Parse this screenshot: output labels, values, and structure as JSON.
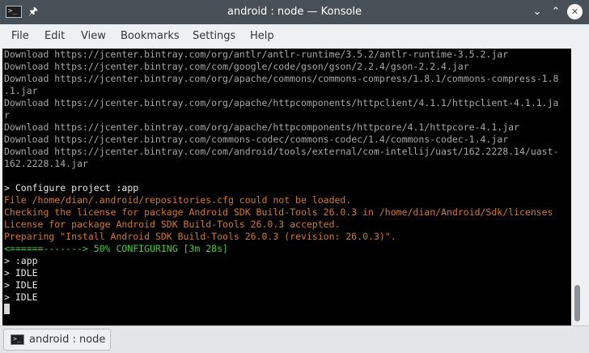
{
  "window": {
    "title": "android : node — Konsole",
    "app_icon": "terminal-icon",
    "pin_icon": "pin-icon",
    "controls": [
      "minimize-icon",
      "maximize-icon",
      "close-icon"
    ]
  },
  "menu": {
    "items": [
      {
        "label": "File"
      },
      {
        "label": "Edit"
      },
      {
        "label": "View"
      },
      {
        "label": "Bookmarks"
      },
      {
        "label": "Settings"
      },
      {
        "label": "Help"
      }
    ]
  },
  "terminal": {
    "background": "#000000",
    "colors": {
      "output": "#a8a8a8",
      "heading": "#e8e8e8",
      "warning": "#d47a22",
      "progress": "#3fcf3f"
    },
    "lines": [
      {
        "style": "output",
        "text": "Download https://jcenter.bintray.com/org/antlr/antlr-runtime/3.5.2/antlr-runtime-3.5.2.jar"
      },
      {
        "style": "output",
        "text": "Download https://jcenter.bintray.com/com/google/code/gson/gson/2.2.4/gson-2.2.4.jar"
      },
      {
        "style": "output",
        "text": "Download https://jcenter.bintray.com/org/apache/commons/commons-compress/1.8.1/commons-compress-1.8"
      },
      {
        "style": "output",
        "text": ".1.jar"
      },
      {
        "style": "output",
        "text": "Download https://jcenter.bintray.com/org/apache/httpcomponents/httpclient/4.1.1/httpclient-4.1.1.ja"
      },
      {
        "style": "output",
        "text": "r"
      },
      {
        "style": "output",
        "text": "Download https://jcenter.bintray.com/org/apache/httpcomponents/httpcore/4.1/httpcore-4.1.jar"
      },
      {
        "style": "output",
        "text": "Download https://jcenter.bintray.com/commons-codec/commons-codec/1.4/commons-codec-1.4.jar"
      },
      {
        "style": "output",
        "text": "Download https://jcenter.bintray.com/com/android/tools/external/com-intellij/uast/162.2228.14/uast-"
      },
      {
        "style": "output",
        "text": "162.2228.14.jar"
      },
      {
        "style": "output",
        "text": ""
      },
      {
        "style": "heading",
        "text": "> Configure project :app"
      },
      {
        "style": "warning",
        "text": "File /home/dian/.android/repositories.cfg could not be loaded."
      },
      {
        "style": "warning",
        "text": "Checking the license for package Android SDK Build-Tools 26.0.3 in /home/dian/Android/Sdk/licenses"
      },
      {
        "style": "warning",
        "text": "License for package Android SDK Build-Tools 26.0.3 accepted."
      },
      {
        "style": "warning",
        "text": "Preparing \"Install Android SDK Build-Tools 26.0.3 (revision: 26.0.3)\"."
      },
      {
        "style": "progress",
        "text": "<======-------> 50% CONFIGURING [3m 28s]"
      },
      {
        "style": "heading",
        "text": "> :app"
      },
      {
        "style": "heading",
        "text": "> IDLE"
      },
      {
        "style": "heading",
        "text": "> IDLE"
      },
      {
        "style": "heading",
        "text": "> IDLE"
      }
    ],
    "scroll_position": 0.97
  },
  "tabs": [
    {
      "label": "android : node",
      "icon": "terminal-icon",
      "active": true
    }
  ]
}
